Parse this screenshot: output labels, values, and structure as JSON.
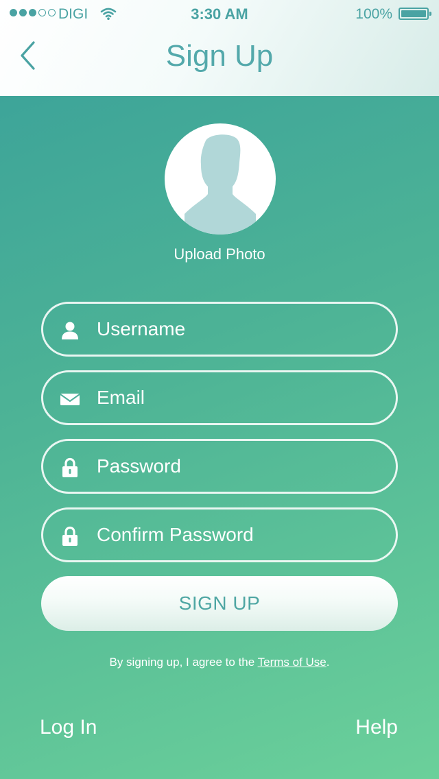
{
  "status_bar": {
    "carrier": "DIGI",
    "time": "3:30 AM",
    "battery_percent": "100%",
    "signal_bars_filled": 3,
    "signal_bars_total": 5,
    "battery_level": 1.0
  },
  "header": {
    "title": "Sign Up",
    "back_icon": "chevron-left-icon"
  },
  "avatar": {
    "upload_label": "Upload Photo",
    "icon": "person-silhouette-icon"
  },
  "form": {
    "username": {
      "placeholder": "Username",
      "value": "",
      "icon": "user-icon"
    },
    "email": {
      "placeholder": "Email",
      "value": "",
      "icon": "envelope-icon"
    },
    "password": {
      "placeholder": "Password",
      "value": "",
      "icon": "lock-icon"
    },
    "confirm_password": {
      "placeholder": "Confirm Password",
      "value": "",
      "icon": "lock-icon"
    },
    "submit_label": "SIGN UP"
  },
  "terms": {
    "prefix": "By signing up, I agree to the ",
    "link_text": "Terms of Use",
    "suffix": "."
  },
  "footer": {
    "login_label": "Log In",
    "help_label": "Help"
  },
  "colors": {
    "accent": "#4aa3a3",
    "gradient_top": "#39a09a",
    "gradient_bottom": "#6bd09a"
  }
}
